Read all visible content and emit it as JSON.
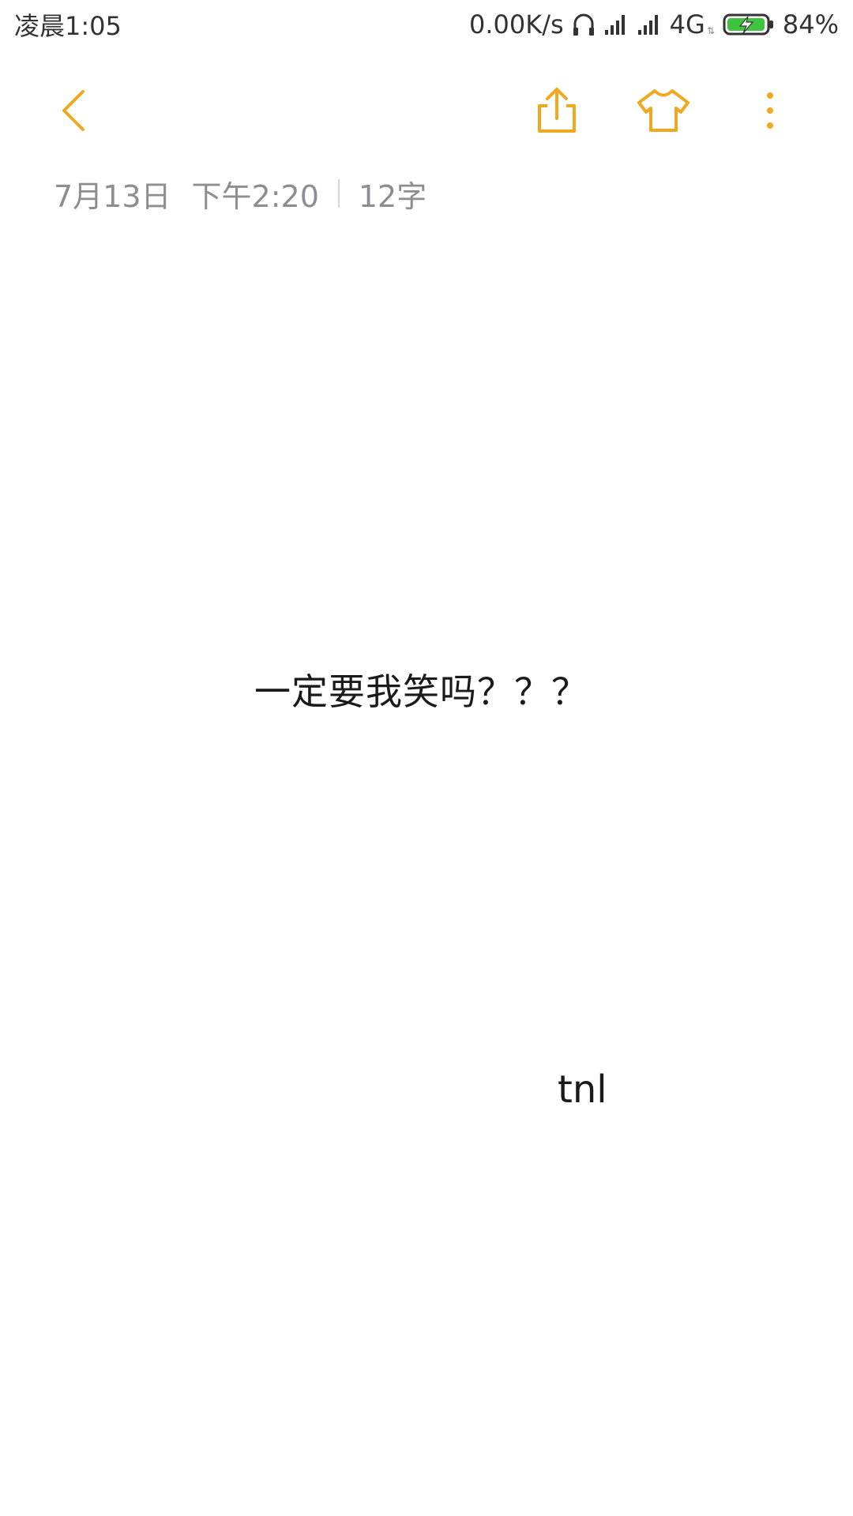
{
  "status_bar": {
    "time": "凌晨1:05",
    "net_speed": "0.00K/s",
    "network_type": "4G",
    "battery": "84%",
    "icons": [
      "headphones-icon",
      "signal-icon",
      "signal-icon",
      "battery-charging-icon"
    ]
  },
  "toolbar": {
    "icons": {
      "back": "chevron-left-icon",
      "share": "share-icon",
      "theme": "tshirt-icon",
      "more": "more-vertical-icon"
    },
    "accent_color": "#f0a91e"
  },
  "meta": {
    "date": "7月13日",
    "time": "下午2:20",
    "word_count": "12字"
  },
  "note": {
    "lines": [
      "一定要我笑吗？？？",
      "tnl"
    ]
  },
  "colors": {
    "background": "#ffffff",
    "meta_text": "#8d8d93",
    "note_text": "#1a1a1a",
    "battery_fill": "#3ec43e"
  }
}
